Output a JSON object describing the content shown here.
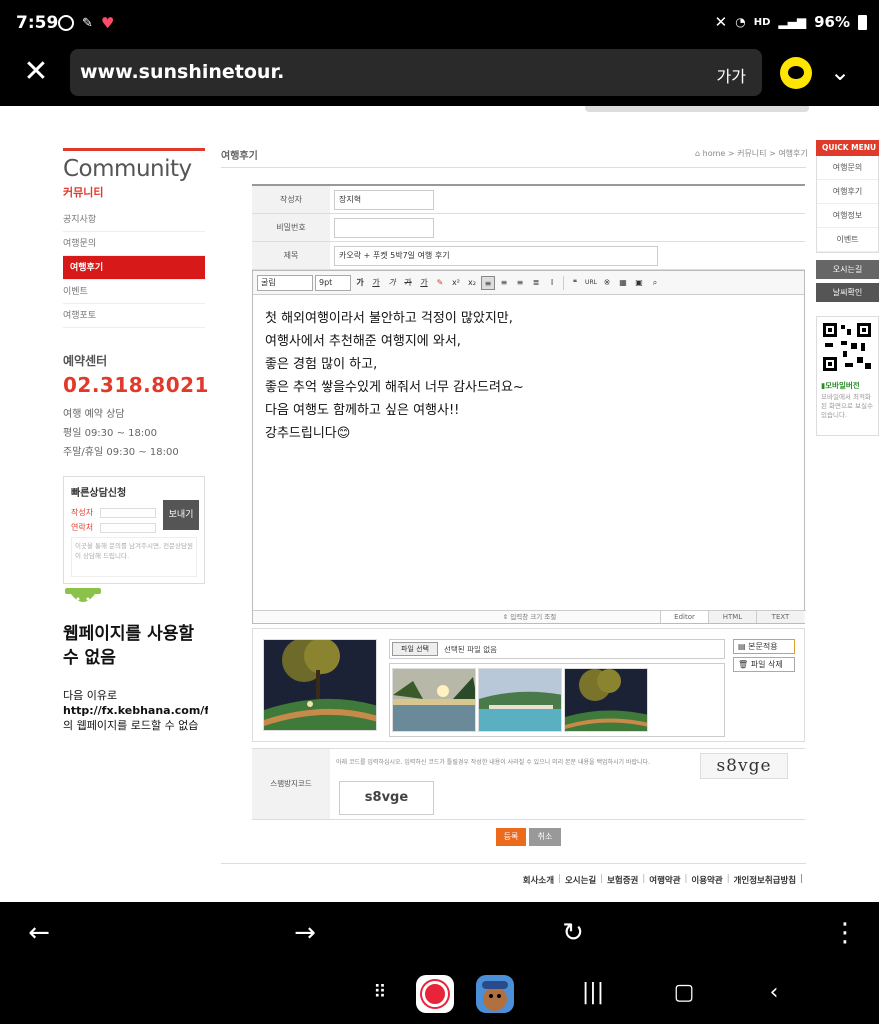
{
  "status_bar": {
    "time": "7:59",
    "battery": "96%",
    "hd": "HD"
  },
  "browser": {
    "url": "www.sunshinetour.",
    "text_size": "가가"
  },
  "sidebar": {
    "title": "Community",
    "title_ko": "커뮤니티",
    "items": [
      {
        "label": "공지사항"
      },
      {
        "label": "여행문의"
      },
      {
        "label": "여행후기"
      },
      {
        "label": "이벤트"
      },
      {
        "label": "여행포토"
      }
    ],
    "reserve_title": "예약센터",
    "phone": "02.318.8021",
    "hours_title": "여행 예약 상담",
    "hours_weekday": "평일 09:30 ~ 18:00",
    "hours_weekend": "주말/휴일 09:30 ~ 18:00",
    "quick_form": {
      "title": "빠른상담신청",
      "name_label": "작성자",
      "contact_label": "연락처",
      "send": "보내기",
      "note": "이곳을 통해 문의를 남겨주시면, 전문상담원이 상담해 드립니다."
    }
  },
  "error": {
    "title": "웹페이지를 사용할 수 없음",
    "body1": "다음 이유로",
    "body2": "http://fx.kebhana.com/fx",
    "body3": "의 웹페이지를 로드할 수 없습"
  },
  "content": {
    "title": "여행후기",
    "breadcrumb": "⌂ home > 커뮤니티 > 여행후기"
  },
  "form": {
    "author_label": "작성자",
    "author_value": "장지혁",
    "password_label": "비밀번호",
    "subject_label": "제목",
    "subject_value": "카오락 + 푸켓 5박7일 여행 후기"
  },
  "editor": {
    "font": "굴림",
    "size": "9pt",
    "body_lines": [
      "첫 해외여행이라서 불안하고 걱정이 많았지만,",
      "여행사에서 추천해준 여행지에 와서,",
      "좋은 경험 많이 하고,",
      "좋은 추억 쌓을수있게 해줘서 너무 감사드려요~",
      "다음 여행도 함께하고 싶은 여행사!!",
      "강추드립니다😊"
    ],
    "resize": "⇕ 입력창 크기 조절",
    "tab_editor": "Editor",
    "tab_html": "HTML",
    "tab_text": "TEXT"
  },
  "attach": {
    "file_button": "파일 선택",
    "no_file": "선택된 파일 없음",
    "apply": "본문적용",
    "delete": "파일 삭제"
  },
  "spam": {
    "label": "스팸방지코드",
    "note": "아래 코드를 입력하십시오. 입력하신 코드가 틀릴경우 작성한 내용이 사라질 수 있으니 미리 본문 내용을 백업하시기 바랍니다.",
    "captcha": "s8vge",
    "input": "s8vge"
  },
  "buttons": {
    "submit": "등록",
    "cancel": "취소"
  },
  "footer": {
    "links": [
      "회사소개",
      "오시는길",
      "보험증권",
      "여행약관",
      "이용약관",
      "개인정보취급방침"
    ]
  },
  "quick_menu": {
    "header": "QUICK MENU",
    "items": [
      "여행문의",
      "여행후기",
      "여행정보",
      "이벤트"
    ],
    "directions": "오시는길",
    "weather": "날씨확인",
    "mobile_title": "모바일버전",
    "mobile_note": "모바일에서 최적화된 화면으로 보실수 있습니다."
  },
  "colors": {
    "accent": "#e03a2b",
    "active_tab": "#d7191a",
    "submit": "#ec6a1c"
  }
}
